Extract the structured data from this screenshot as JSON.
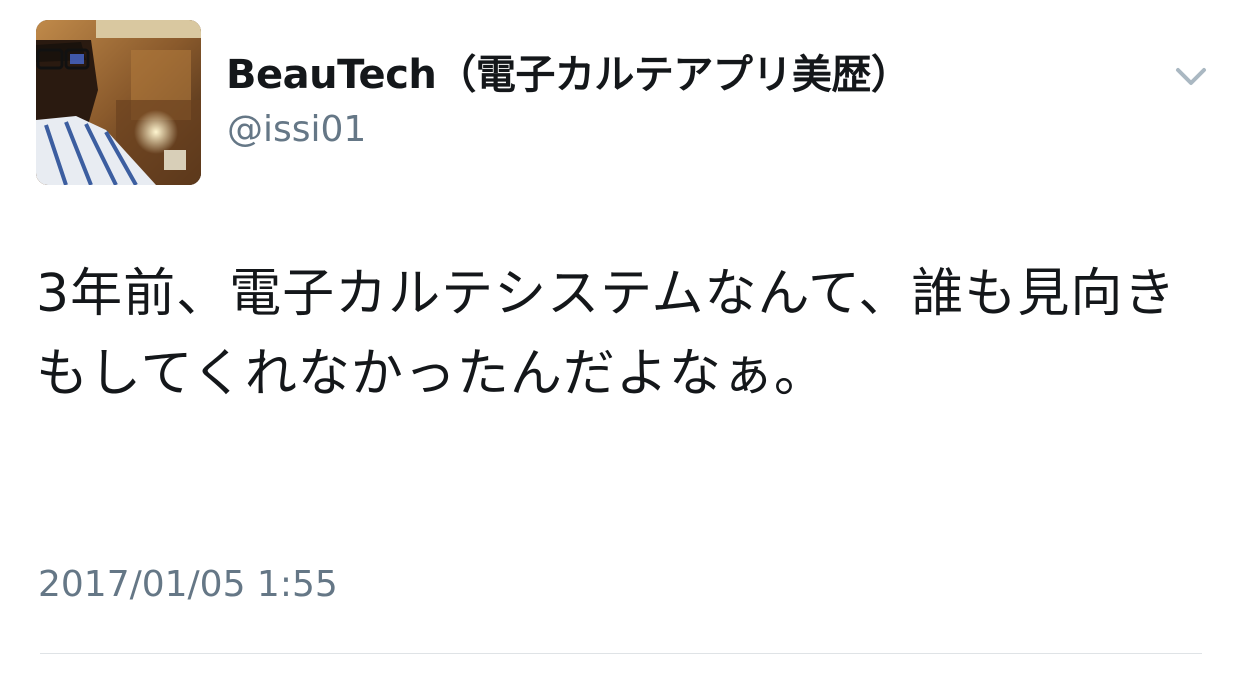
{
  "author": {
    "display_name": "BeauTech（電子カルテアプリ美歴）",
    "handle": "@issi01",
    "avatar_icon": "profile-photo"
  },
  "tweet": {
    "text": "3年前、電子カルテシステムなんて、誰も見向きもしてくれなかったんだよなぁ。",
    "timestamp": "2017/01/05 1:55"
  },
  "menu": {
    "icon": "chevron-down-icon"
  },
  "colors": {
    "text_primary": "#14171a",
    "text_secondary": "#657786",
    "chevron": "#aab8c2",
    "divider": "#dfe3e6"
  }
}
